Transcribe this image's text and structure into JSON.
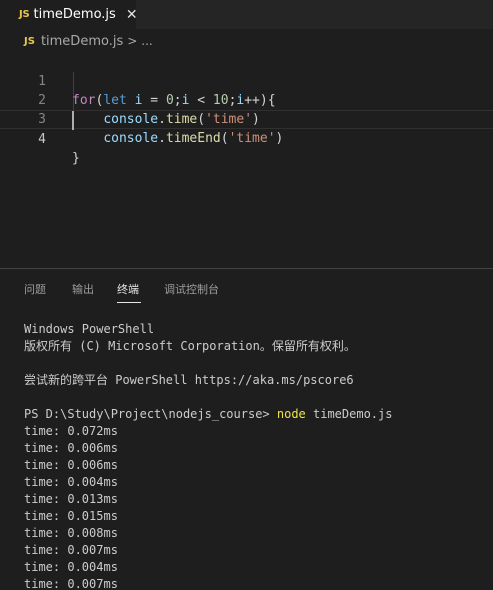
{
  "editor_tab": {
    "lang_badge": "JS",
    "filename": "timeDemo.js",
    "close_glyph": "✕"
  },
  "breadcrumb": {
    "lang_badge": "JS",
    "filename": "timeDemo.js",
    "separator": ">",
    "more": "..."
  },
  "code": {
    "lines": [
      {
        "number": "1"
      },
      {
        "number": "2"
      },
      {
        "number": "3"
      },
      {
        "number": "4"
      }
    ],
    "tokens": {
      "for": "for",
      "paren_open": "(",
      "let": "let",
      "space": " ",
      "i": "i",
      "assign": " = ",
      "zero": "0",
      "semicolon": ";",
      "lt": " < ",
      "ten": "10",
      "incr": "++",
      "paren_brace": "){",
      "indent": "    ",
      "console": "console",
      "dot": ".",
      "time_fn": "time",
      "timeend_fn": "timeEnd",
      "open": "(",
      "close": ")",
      "str_time": "'time'",
      "brace_close": "}"
    }
  },
  "panel": {
    "tabs": [
      "问题",
      "输出",
      "终端",
      "调试控制台"
    ],
    "active_tab": "终端"
  },
  "terminal": {
    "lines": [
      "Windows PowerShell",
      "版权所有 (C) Microsoft Corporation。保留所有权利。",
      "",
      "尝试新的跨平台 PowerShell https://aka.ms/pscore6",
      ""
    ],
    "prompt": "PS D:\\Study\\Project\\nodejs_course> ",
    "command": "node",
    "command_args": " timeDemo.js",
    "output": [
      "time: 0.072ms",
      "time: 0.006ms",
      "time: 0.006ms",
      "time: 0.004ms",
      "time: 0.013ms",
      "time: 0.015ms",
      "time: 0.008ms",
      "time: 0.007ms",
      "time: 0.004ms",
      "time: 0.007ms"
    ]
  },
  "colors": {
    "background": "#1e1e1e",
    "keyword": "#c586c0",
    "declaration": "#569cd6",
    "variable": "#9cdcfe",
    "number": "#b5cea8",
    "string": "#ce9178",
    "function": "#dcdcaa",
    "js_badge": "#e8c74a",
    "terminal_command": "#f0e34a"
  }
}
